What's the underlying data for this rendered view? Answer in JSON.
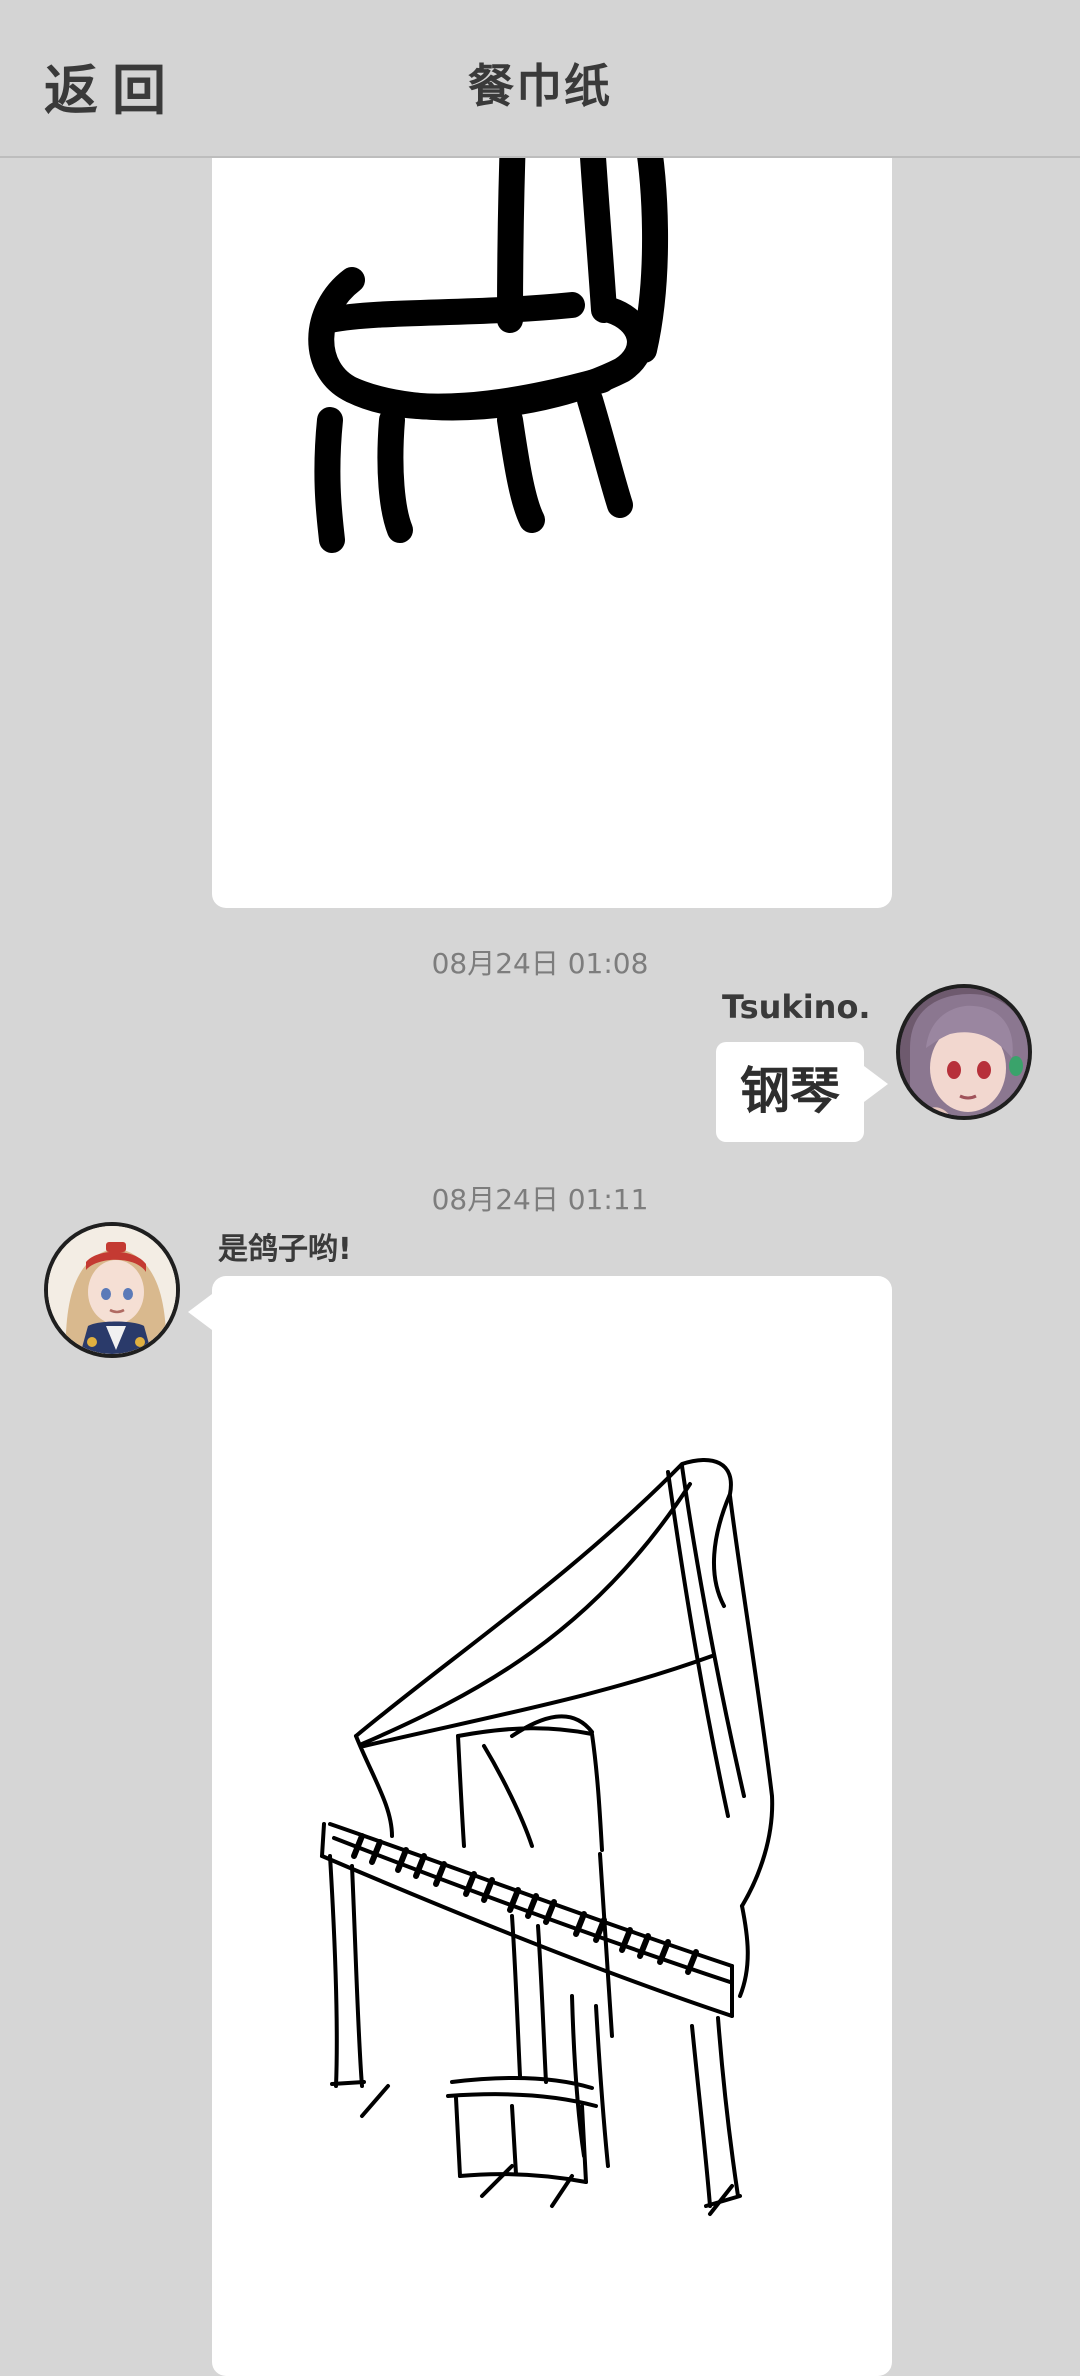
{
  "header": {
    "back_label": "返回",
    "title": "餐巾纸"
  },
  "messages": [
    {
      "type": "drawing",
      "side": "left",
      "drawing_icon": "chair-sketch"
    },
    {
      "timestamp": "08月24日  01:08",
      "sender": "Tsukino.",
      "side": "right",
      "type": "text",
      "text": "钢琴",
      "avatar_icon": "anime-girl-purple-hair-avatar"
    },
    {
      "timestamp": "08月24日  01:11",
      "sender": "是鸽子哟!",
      "side": "left",
      "type": "drawing",
      "drawing_icon": "grand-piano-sketch",
      "avatar_icon": "anime-girl-blonde-hair-avatar"
    }
  ],
  "colors": {
    "background": "#d6d6d6",
    "card": "#ffffff",
    "text_primary": "#3a3a3a",
    "timestamp": "#7d7d7d"
  }
}
